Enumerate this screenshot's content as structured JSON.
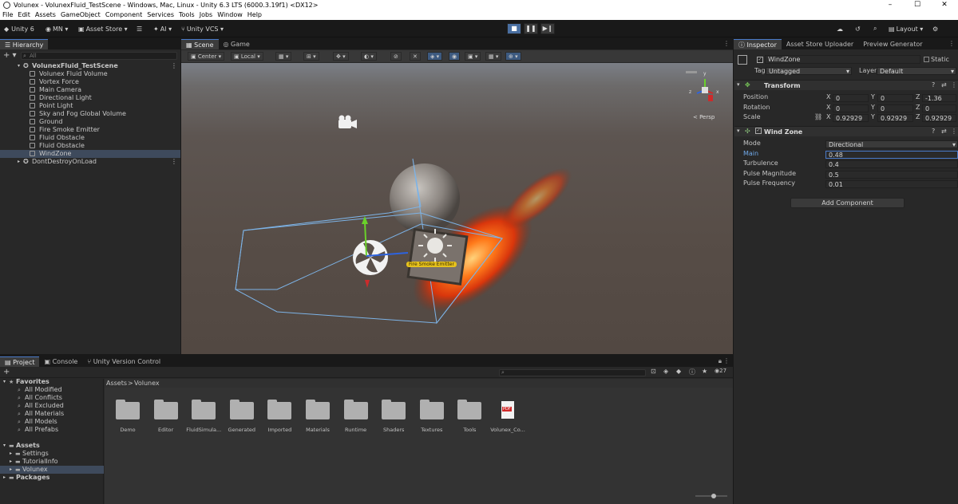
{
  "window": {
    "title": "Volunex - VolunexFluid_TestScene - Windows, Mac, Linux - Unity 6.3 LTS (6000.3.19f1) <DX12>",
    "controls": [
      "–",
      "☐",
      "✕"
    ]
  },
  "menu": [
    "File",
    "Edit",
    "Assets",
    "GameObject",
    "Component",
    "Services",
    "Tools",
    "Jobs",
    "Window",
    "Help"
  ],
  "toolbar": {
    "unity": "Unity 6",
    "account": "MN ▾",
    "asset_store": "Asset Store ▾",
    "ai": "AI ▾",
    "vcs": "Unity VCS ▾",
    "layout": "Layout ▾"
  },
  "hierarchy": {
    "tab": "Hierarchy",
    "search_placeholder": "All",
    "items": [
      {
        "label": "VolunexFluid_TestScene",
        "depth": 0,
        "type": "scene"
      },
      {
        "label": "Volunex Fluid Volume",
        "depth": 1,
        "type": "object"
      },
      {
        "label": "Vortex Force",
        "depth": 1,
        "type": "object"
      },
      {
        "label": "Main Camera",
        "depth": 1,
        "type": "object"
      },
      {
        "label": "Directional Light",
        "depth": 1,
        "type": "object"
      },
      {
        "label": "Point Light",
        "depth": 1,
        "type": "object"
      },
      {
        "label": "Sky and Fog Global Volume",
        "depth": 1,
        "type": "object"
      },
      {
        "label": "Ground",
        "depth": 1,
        "type": "object"
      },
      {
        "label": "Fire Smoke Emitter",
        "depth": 1,
        "type": "object"
      },
      {
        "label": "Fluid Obstacle",
        "depth": 1,
        "type": "object"
      },
      {
        "label": "Fluid Obstacle",
        "depth": 1,
        "type": "object"
      },
      {
        "label": "WindZone",
        "depth": 1,
        "type": "object",
        "selected": true
      },
      {
        "label": "DontDestroyOnLoad",
        "depth": 0,
        "type": "scene"
      }
    ]
  },
  "scene": {
    "tabs": [
      "Scene",
      "Game"
    ],
    "pivot": "Center",
    "space": "Local",
    "persp": "< Persp",
    "gizmo_axes": [
      "y",
      "x",
      "z"
    ],
    "emitter_label": "Fire Smoke Emitter"
  },
  "inspector": {
    "tabs": [
      "Inspector",
      "Asset Store Uploader",
      "Preview Generator"
    ],
    "object_name": "WindZone",
    "static_label": "Static",
    "tag_label": "Tag",
    "tag_value": "Untagged",
    "layer_label": "Layer",
    "layer_value": "Default",
    "transform": {
      "title": "Transform",
      "rows": [
        {
          "label": "Position",
          "x": "0",
          "y": "0",
          "z": "-1.36"
        },
        {
          "label": "Rotation",
          "x": "0",
          "y": "0",
          "z": "0"
        },
        {
          "label": "Scale",
          "x": "0.92929",
          "y": "0.92929",
          "z": "0.92929"
        }
      ],
      "axis_labels": [
        "X",
        "Y",
        "Z"
      ]
    },
    "windzone": {
      "title": "Wind Zone",
      "rows": [
        {
          "label": "Mode",
          "value": "Directional"
        },
        {
          "label": "Main",
          "value": "0.48"
        },
        {
          "label": "Turbulence",
          "value": "0.4"
        },
        {
          "label": "Pulse Magnitude",
          "value": "0.5"
        },
        {
          "label": "Pulse Frequency",
          "value": "0.01"
        }
      ]
    },
    "add_component": "Add Component"
  },
  "project": {
    "tabs": [
      "Project",
      "Console",
      "Unity Version Control"
    ],
    "favorites_label": "Favorites",
    "favorites": [
      "All Modified",
      "All Conflicts",
      "All Excluded",
      "All Materials",
      "All Models",
      "All Prefabs"
    ],
    "assets_label": "Assets",
    "asset_folders": [
      "Settings",
      "TutorialInfo",
      "Volunex"
    ],
    "packages_label": "Packages",
    "breadcrumb": [
      "Assets",
      ">",
      "Volunex"
    ],
    "count": "27",
    "items": [
      "Demo",
      "Editor",
      "FluidSimula...",
      "Generated",
      "Imported",
      "Materials",
      "Runtime",
      "Shaders",
      "Textures",
      "Tools",
      "Volunex_Co..."
    ],
    "pdf_badge": "PDF"
  }
}
